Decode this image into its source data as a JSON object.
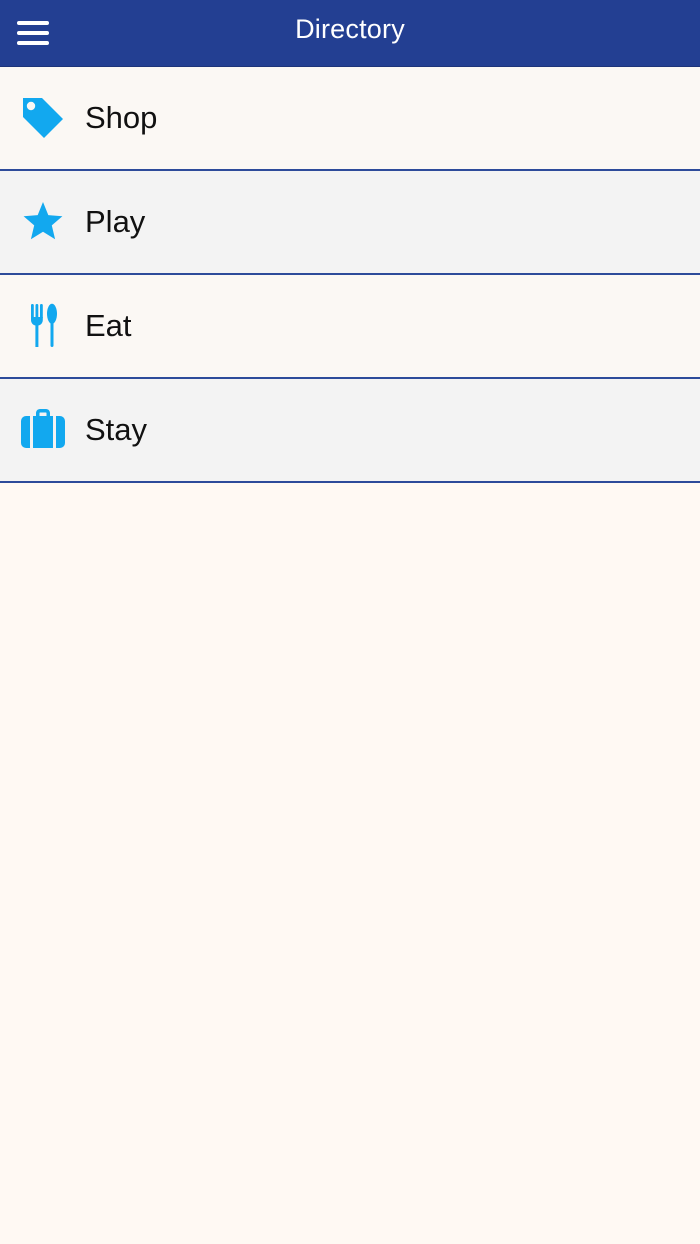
{
  "header": {
    "title": "Directory",
    "menu_icon": "hamburger-menu-icon"
  },
  "colors": {
    "header_background": "#233f92",
    "accent_icon": "#12a8ef",
    "divider": "#2d4b9a",
    "row_odd": "#fbf8f4",
    "row_even": "#f3f3f3",
    "page_background": "#fff9f3"
  },
  "menu": {
    "items": [
      {
        "label": "Shop",
        "icon": "tag-icon"
      },
      {
        "label": "Play",
        "icon": "star-icon"
      },
      {
        "label": "Eat",
        "icon": "fork-spoon-icon"
      },
      {
        "label": "Stay",
        "icon": "suitcase-icon"
      }
    ]
  }
}
